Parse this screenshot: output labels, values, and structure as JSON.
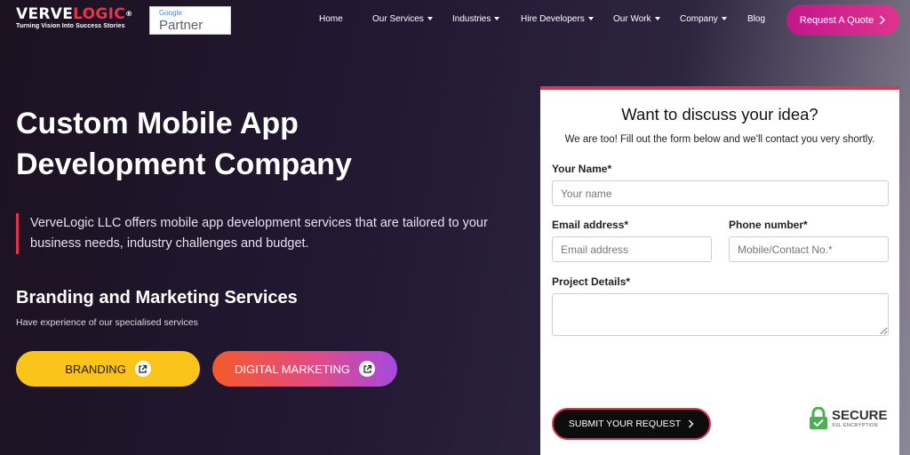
{
  "header": {
    "logo_part1": "VERVE",
    "logo_part2": "LOGIC",
    "logo_reg": "®",
    "logo_tagline": "Turning Vision Into Success Stories",
    "partner_google": "Google",
    "partner_label": "Partner",
    "nav": [
      {
        "label": "Home"
      },
      {
        "label": "Our Services"
      },
      {
        "label": "Industries"
      },
      {
        "label": "Hire Developers"
      },
      {
        "label": "Our Work"
      },
      {
        "label": "Company"
      },
      {
        "label": "Blog"
      }
    ],
    "quote_button": "Request A Quote"
  },
  "hero": {
    "title_line1": "Custom Mobile App",
    "title_line2": "Development Company",
    "description": "VerveLogic LLC offers mobile app development services that are tailored to your business needs, industry challenges and budget.",
    "sub_title": "Branding and Marketing Services",
    "sub_note": "Have experience of our specialised services",
    "button_branding": "BRANDING",
    "button_marketing": "DIGITAL MARKETING"
  },
  "form": {
    "title": "Want to discuss your idea?",
    "subtitle": "We are too! Fill out the form below and we'll contact you very shortly.",
    "name_label": "Your Name*",
    "name_placeholder": "Your name",
    "email_label": "Email address*",
    "email_placeholder": "Email address",
    "phone_label": "Phone number*",
    "phone_placeholder": "Mobile/Contact No.*",
    "project_label": "Project Details*",
    "submit_label": "SUBMIT YOUR REQUEST",
    "secure_label": "SECURE",
    "secure_sub": "SSL ENCRYPTION"
  },
  "colors": {
    "accent_red": "#e0334c",
    "quote_pink": "#d0228e",
    "branding_yellow": "#fbc41a",
    "secure_green": "#4caf50"
  }
}
